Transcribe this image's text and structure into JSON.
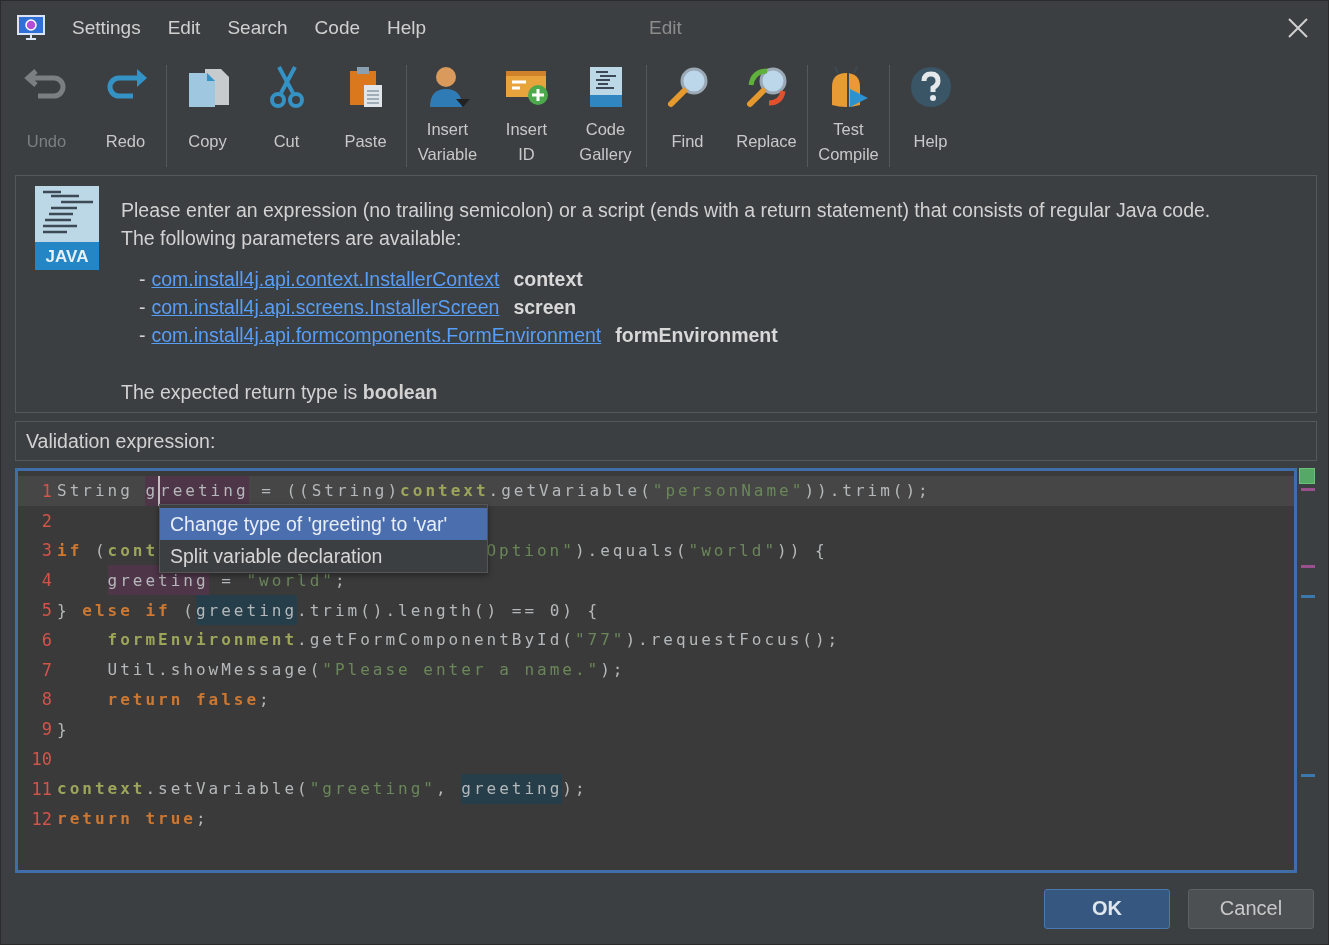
{
  "window": {
    "title": "Edit"
  },
  "menu": [
    "Settings",
    "Edit",
    "Search",
    "Code",
    "Help"
  ],
  "toolbar": {
    "groups": [
      [
        {
          "label": "Undo",
          "disabled": true
        },
        {
          "label": "Redo",
          "disabled": false
        }
      ],
      [
        {
          "label": "Copy",
          "disabled": false
        },
        {
          "label": "Cut",
          "disabled": false
        },
        {
          "label": "Paste",
          "disabled": false
        }
      ],
      [
        {
          "label": "Insert\nVariable",
          "disabled": false
        },
        {
          "label": "Insert\nID",
          "disabled": false
        },
        {
          "label": "Code\nGallery",
          "disabled": false
        }
      ],
      [
        {
          "label": "Find",
          "disabled": false
        },
        {
          "label": "Replace",
          "disabled": false
        }
      ],
      [
        {
          "label": "Test\nCompile",
          "disabled": false
        }
      ],
      [
        {
          "label": "Help",
          "disabled": false
        }
      ]
    ]
  },
  "info": {
    "badge": "JAVA",
    "intro": [
      "Please enter an expression (no trailing semicolon) or a script (ends with a return statement) that consists of regular Java code.",
      "The following parameters are available:"
    ],
    "parameters": [
      {
        "marker": "-",
        "type": "com.install4j.api.context.InstallerContext",
        "name": "context"
      },
      {
        "marker": "-",
        "type": "com.install4j.api.screens.InstallerScreen",
        "name": "screen"
      },
      {
        "marker": "-",
        "type": "com.install4j.api.formcomponents.FormEnvironment",
        "name": "formEnvironment"
      }
    ],
    "return_note": "The expected return type is **boolean**"
  },
  "field_label": "Validation expression:",
  "editor": {
    "lines": [
      {
        "number": "1",
        "current": true,
        "tokens": [
          {
            "kind": "plain",
            "text": "String "
          },
          {
            "kind": "plain",
            "text": "g",
            "written": true
          },
          {
            "kind": "plain",
            "text": "reeting",
            "written": true,
            "caret": true
          },
          {
            "kind": "plain",
            "text": " = ((String)"
          },
          {
            "kind": "field",
            "text": "context"
          },
          {
            "kind": "plain",
            "text": ".getVariable("
          },
          {
            "kind": "string",
            "text": "\"personName\""
          },
          {
            "kind": "plain",
            "text": ")).trim();"
          }
        ]
      },
      {
        "number": "2",
        "current": false
      },
      {
        "number": "3",
        "current": false,
        "tokens": [
          {
            "kind": "keyword",
            "text": "if"
          },
          {
            "kind": "plain",
            "text": " ("
          },
          {
            "kind": "field",
            "text": "cont"
          },
          {
            "kind": "covered"
          },
          {
            "kind": "string",
            "text": "Option\""
          },
          {
            "kind": "plain",
            "text": ").equals("
          },
          {
            "kind": "string",
            "text": "\"world\""
          },
          {
            "kind": "plain",
            "text": ")) {"
          }
        ]
      },
      {
        "number": "4",
        "current": false,
        "indented": true,
        "tokens": [
          {
            "kind": "plain",
            "text": "greeting",
            "written": true
          },
          {
            "kind": "plain",
            "text": " = "
          },
          {
            "kind": "string",
            "text": "\"world\""
          },
          {
            "kind": "plain",
            "text": ";"
          }
        ]
      },
      {
        "number": "5",
        "current": false,
        "tokens": [
          {
            "kind": "plain",
            "text": "} "
          },
          {
            "kind": "keyword",
            "text": "else if"
          },
          {
            "kind": "plain",
            "text": " ("
          },
          {
            "kind": "plain",
            "text": "greeting",
            "read": true
          },
          {
            "kind": "plain",
            "text": ".trim().length() == 0) {"
          }
        ]
      },
      {
        "number": "6",
        "current": false,
        "indented": true,
        "tokens": [
          {
            "kind": "field",
            "text": "formEnvironment"
          },
          {
            "kind": "plain",
            "text": ".getFormComponentById("
          },
          {
            "kind": "string",
            "text": "\"77\""
          },
          {
            "kind": "plain",
            "text": ").requestFocus();"
          }
        ]
      },
      {
        "number": "7",
        "current": false,
        "indented": true,
        "tokens": [
          {
            "kind": "plain",
            "text": "Util.showMessage("
          },
          {
            "kind": "string",
            "text": "\"Please enter a name.\""
          },
          {
            "kind": "plain",
            "text": ");"
          }
        ]
      },
      {
        "number": "8",
        "current": false,
        "indented": true,
        "tokens": [
          {
            "kind": "keyword",
            "text": "return false"
          },
          {
            "kind": "plain",
            "text": ";"
          }
        ]
      },
      {
        "number": "9",
        "current": false,
        "tokens": [
          {
            "kind": "plain",
            "text": "}"
          }
        ]
      },
      {
        "number": "10",
        "current": false
      },
      {
        "number": "11",
        "current": false,
        "tokens": [
          {
            "kind": "field",
            "text": "context"
          },
          {
            "kind": "plain",
            "text": ".setVariable("
          },
          {
            "kind": "string",
            "text": "\"greeting\""
          },
          {
            "kind": "plain",
            "text": ", "
          },
          {
            "kind": "plain",
            "text": "greeting",
            "read": true
          },
          {
            "kind": "plain",
            "text": ");"
          }
        ]
      },
      {
        "number": "12",
        "current": false,
        "tokens": [
          {
            "kind": "keyword",
            "text": "return true"
          },
          {
            "kind": "plain",
            "text": ";"
          }
        ]
      }
    ],
    "popup": [
      {
        "label": "Change type of 'greeting' to 'var'",
        "selected": true
      },
      {
        "label": "Split variable declaration",
        "selected": false
      }
    ]
  },
  "buttons": [
    {
      "label": "OK",
      "kind": "primary"
    },
    {
      "label": "Cancel",
      "kind": "secondary"
    }
  ]
}
